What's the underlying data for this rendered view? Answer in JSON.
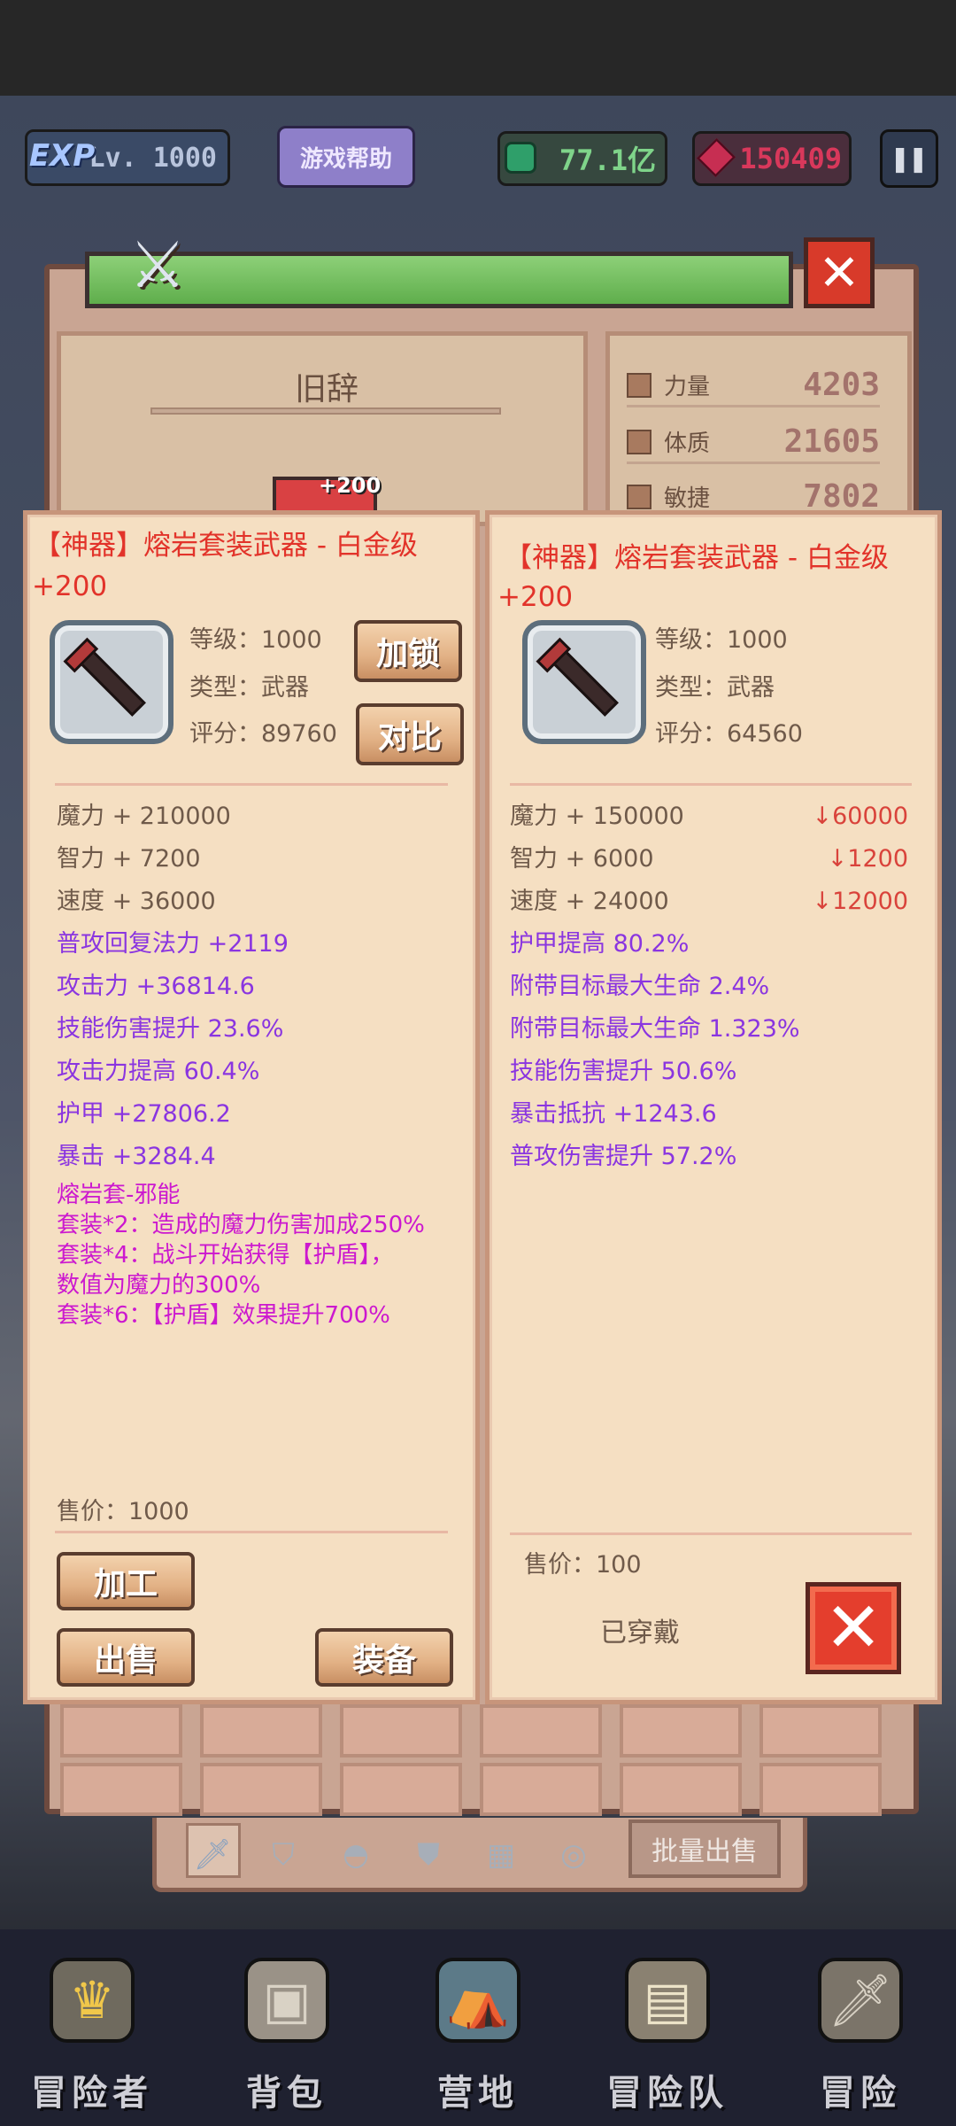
{
  "hud": {
    "exp_badge": "EXP",
    "level": "Lv. 1000",
    "help_button": "游戏帮助",
    "gems": "77.1亿",
    "rubies": "150409",
    "pause_icon": "pause-icon"
  },
  "character": {
    "name": "旧辞",
    "portrait_plus": "+200",
    "stats": [
      {
        "label": "力量",
        "value": "4203"
      },
      {
        "label": "体质",
        "value": "21605"
      },
      {
        "label": "敏捷",
        "value": "7802"
      }
    ]
  },
  "left_card": {
    "title_line1": "【神器】熔岩套装武器 - 白金级",
    "title_line2": "+200",
    "level": "等级：1000",
    "type": "类型：武器",
    "score": "评分：89760",
    "lock_button": "加锁",
    "compare_button": "对比",
    "base_attrs": [
      "魔力 + 210000",
      "智力 + 7200",
      "速度 + 36000"
    ],
    "bonus_attrs": [
      "普攻回复法力 +2119",
      "攻击力 +36814.6",
      "技能伤害提升 23.6%",
      "攻击力提高 60.4%",
      "护甲 +27806.2",
      "暴击 +3284.4"
    ],
    "set_lines": [
      "熔岩套-邪能",
      "套装*2：造成的魔力伤害加成250%",
      "套装*4：战斗开始获得【护盾】，",
      "数值为魔力的300%",
      "套装*6：【护盾】效果提升700%"
    ],
    "price": "售价：1000",
    "craft_button": "加工",
    "sell_button": "出售",
    "equip_button": "装备"
  },
  "right_card": {
    "title_line1": "【神器】熔岩套装武器 - 白金级",
    "title_line2": "+200",
    "level": "等级：1000",
    "type": "类型：武器",
    "score": "评分：64560",
    "base_attrs": [
      {
        "text": "魔力 + 150000",
        "diff": "↓60000"
      },
      {
        "text": "智力 + 6000",
        "diff": "↓1200"
      },
      {
        "text": "速度 + 24000",
        "diff": "↓12000"
      }
    ],
    "bonus_attrs": [
      "护甲提高 80.2%",
      "附带目标最大生命 2.4%",
      "附带目标最大生命 1.323%",
      "技能伤害提升 50.6%",
      "暴击抵抗 +1243.6",
      "普攻伤害提升 57.2%"
    ],
    "price": "售价：100",
    "equipped_label": "已穿戴"
  },
  "inventory": {
    "bulk_sell": "批量出售"
  },
  "nav": [
    {
      "label": "冒险者",
      "icon": "crown-icon"
    },
    {
      "label": "背包",
      "icon": "backpack-icon"
    },
    {
      "label": "营地",
      "icon": "camp-icon"
    },
    {
      "label": "冒险队",
      "icon": "book-icon"
    },
    {
      "label": "冒险",
      "icon": "sword-icon"
    }
  ]
}
